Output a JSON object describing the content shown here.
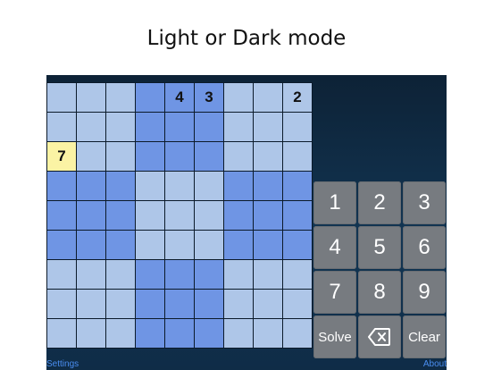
{
  "headline": "Light or Dark mode",
  "board": [
    [
      "",
      "",
      "",
      "",
      "4",
      "3",
      "",
      "",
      "2"
    ],
    [
      "",
      "",
      "",
      "",
      "",
      "",
      "",
      "",
      ""
    ],
    [
      "7",
      "",
      "",
      "",
      "",
      "",
      "",
      "",
      ""
    ],
    [
      "",
      "",
      "",
      "",
      "",
      "",
      "",
      "",
      ""
    ],
    [
      "",
      "",
      "",
      "",
      "",
      "",
      "",
      "",
      ""
    ],
    [
      "",
      "",
      "",
      "",
      "",
      "",
      "",
      "",
      ""
    ],
    [
      "",
      "",
      "",
      "",
      "",
      "",
      "",
      "",
      ""
    ],
    [
      "",
      "",
      "",
      "",
      "",
      "",
      "",
      "",
      ""
    ],
    [
      "",
      "",
      "",
      "",
      "",
      "",
      "",
      "",
      ""
    ]
  ],
  "selected_cell": {
    "row": 2,
    "col": 0
  },
  "keypad": {
    "digits": [
      "1",
      "2",
      "3",
      "4",
      "5",
      "6",
      "7",
      "8",
      "9"
    ],
    "solve_label": "Solve",
    "delete_icon": "backspace-icon",
    "clear_label": "Clear"
  },
  "footer": {
    "settings_label": "Settings",
    "about_label": "About"
  },
  "colors": {
    "cell_light": "#aec6e8",
    "cell_dark": "#6f95e4",
    "cell_selected": "#fbf3a4",
    "key_bg": "#777b80",
    "link": "#4a8df0"
  }
}
